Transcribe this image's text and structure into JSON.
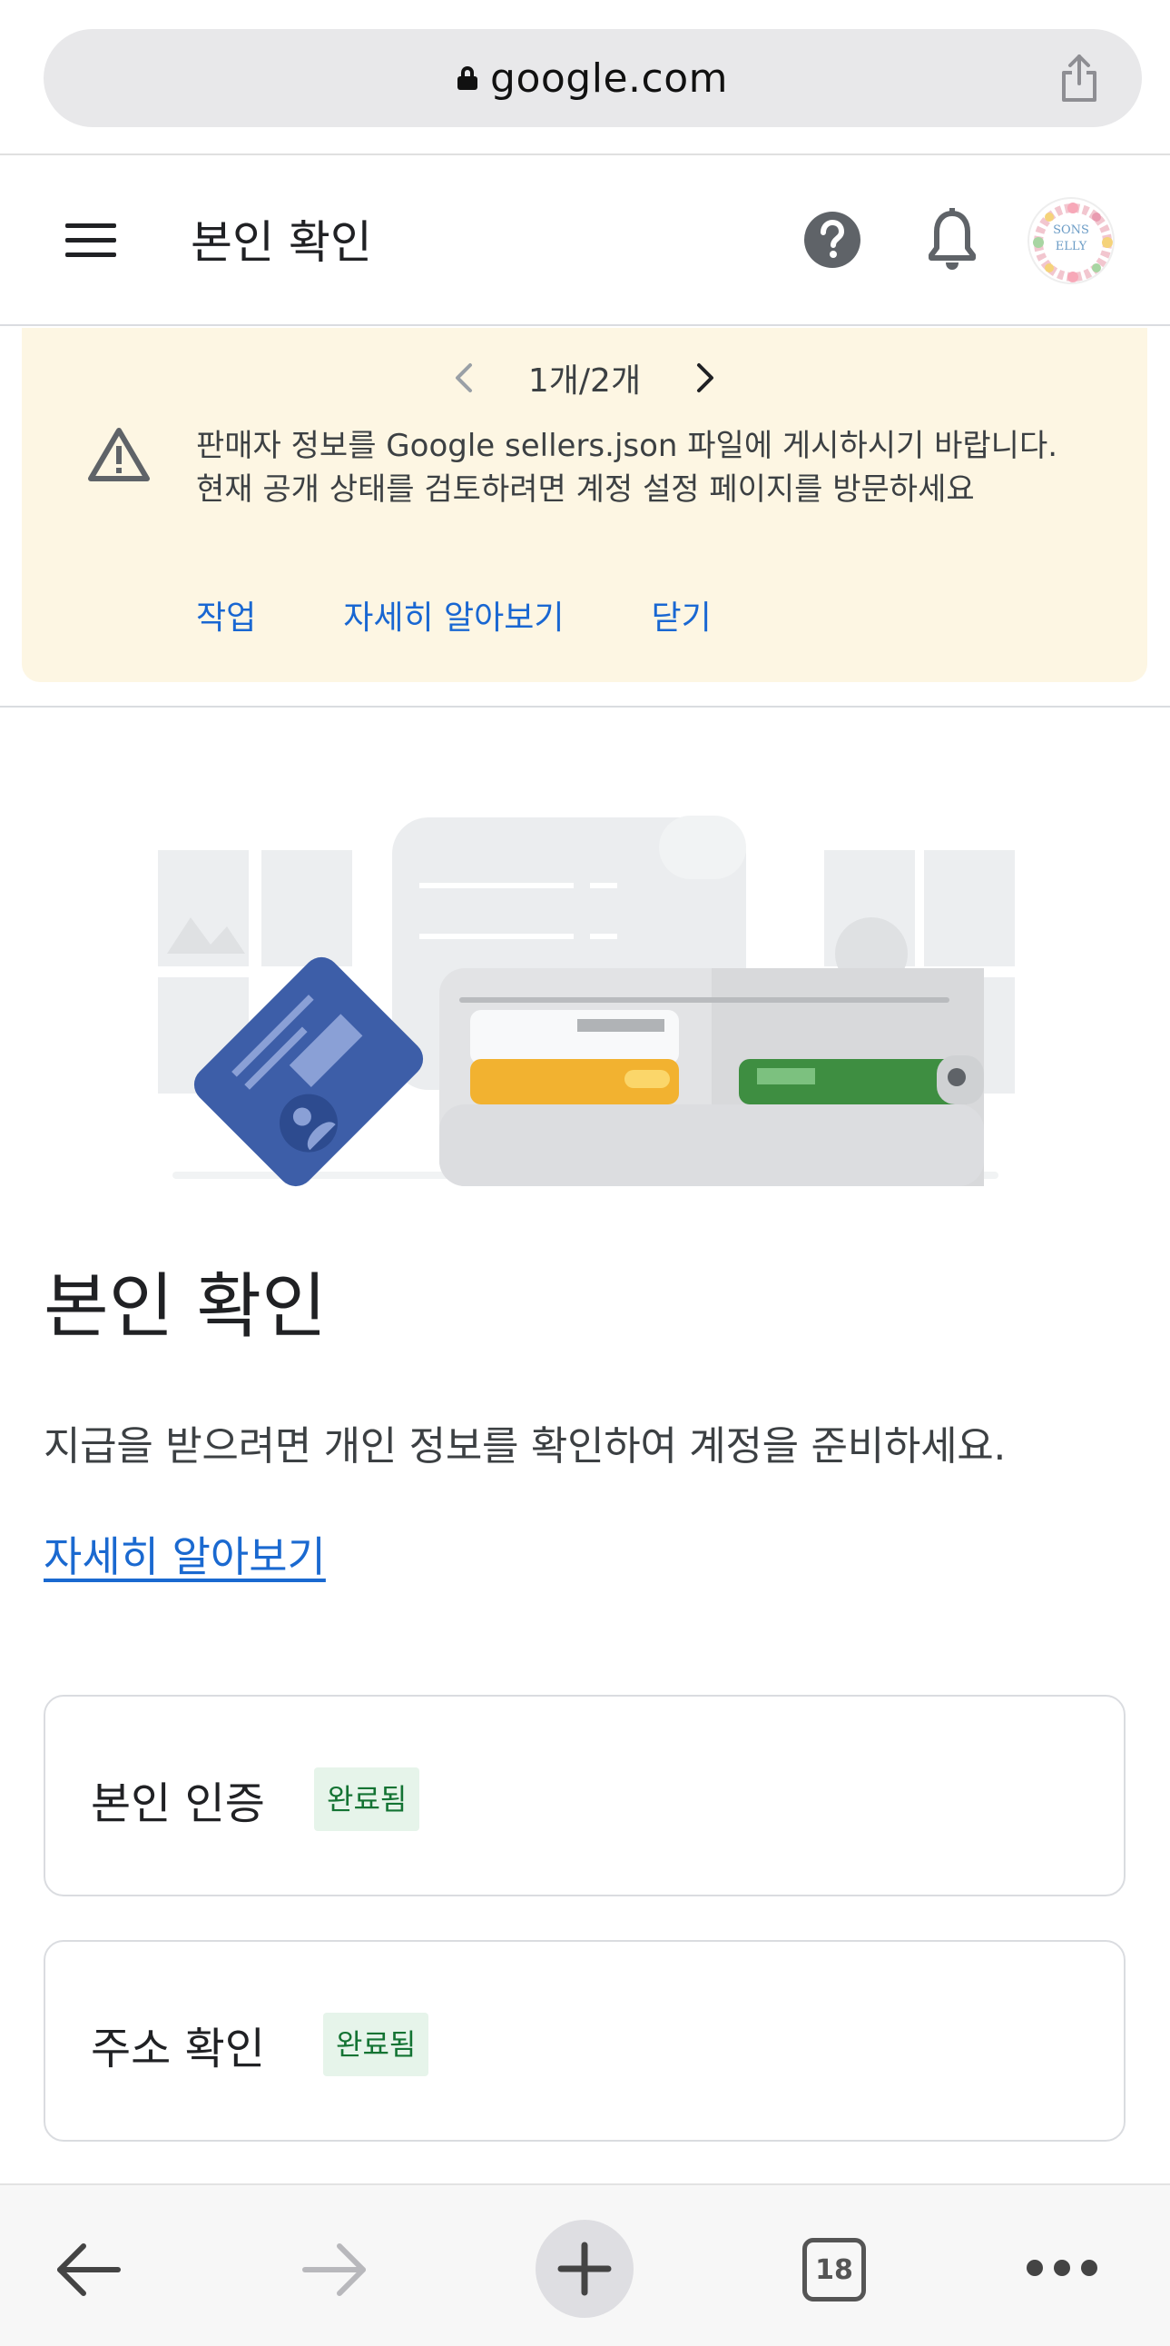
{
  "browser": {
    "url": "google.com",
    "tab_count": "18"
  },
  "appbar": {
    "title": "본인 확인"
  },
  "avatar": {
    "line1": "SONS",
    "line2": "ELLY"
  },
  "banner": {
    "pager": "1개/2개",
    "message": "판매자 정보를 Google sellers.json 파일에 게시하시기 바랍니다. 현재 공개 상태를 검토하려면 계정 설정 페이지를 방문하세요",
    "actions": {
      "action": "작업",
      "learn_more": "자세히 알아보기",
      "close": "닫기"
    }
  },
  "content": {
    "title": "본인 확인",
    "description": "지급을 받으려면 개인 정보를 확인하여 계정을 준비하세요.",
    "learn_more": "자세히 알아보기"
  },
  "cards": [
    {
      "label": "본인 인증",
      "status": "완료됨"
    },
    {
      "label": "주소 확인",
      "status": "완료됨"
    }
  ],
  "colors": {
    "banner_bg": "#fdf6e3",
    "link": "#1a69d0",
    "badge_bg": "#e6f4ea",
    "badge_text": "#137333"
  }
}
